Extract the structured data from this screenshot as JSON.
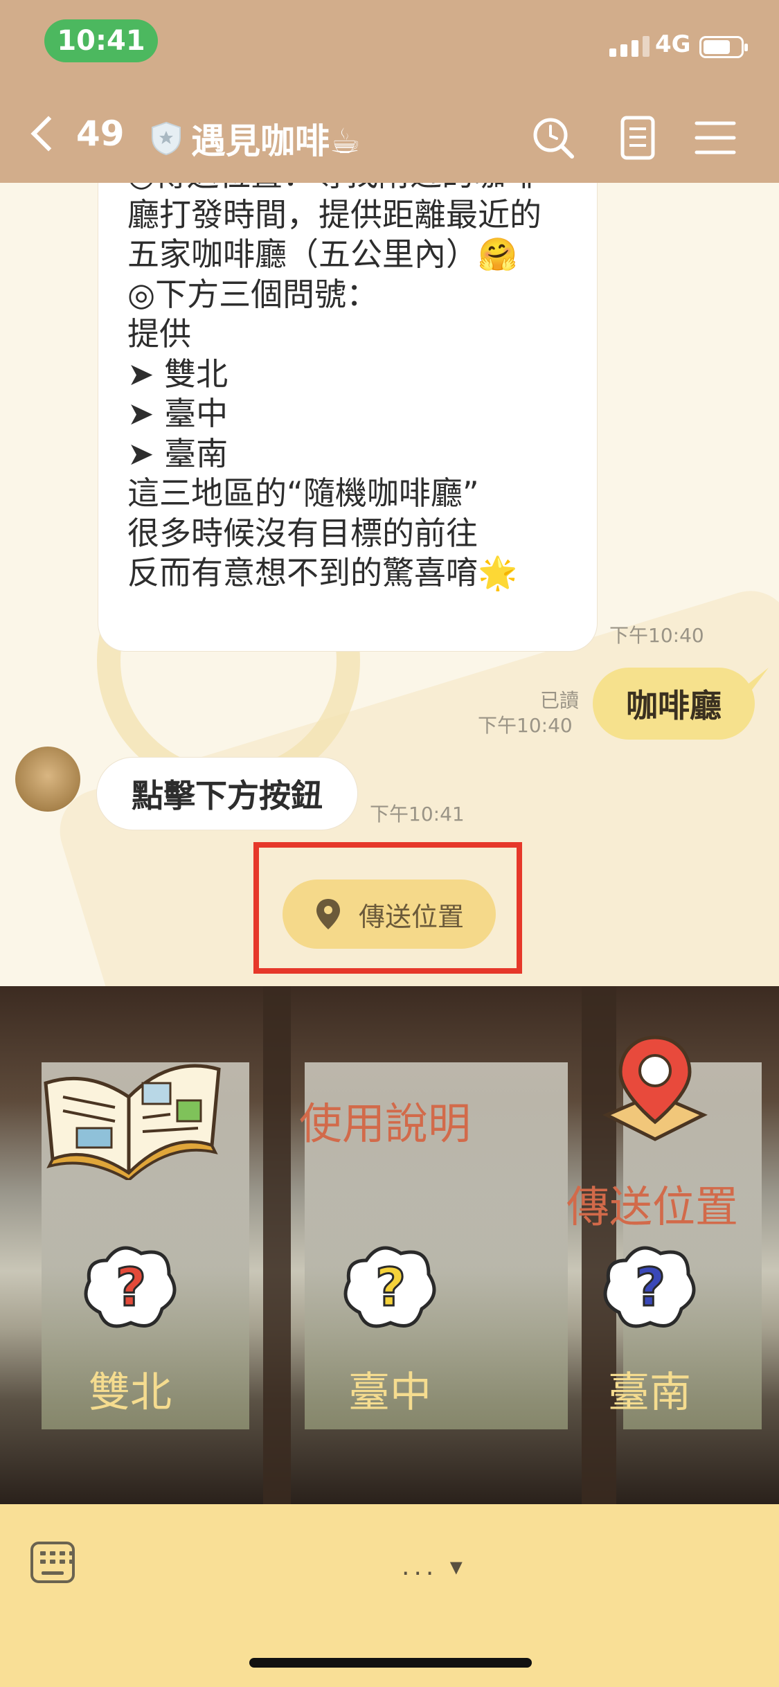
{
  "status": {
    "time": "10:41",
    "network": "4G"
  },
  "nav": {
    "back_count": "49",
    "title": "遇見咖啡☕"
  },
  "chat": {
    "long_message_lines": [
      "◎傳送位置：尋找附近的咖啡",
      "廳打發時間，提供距離最近的",
      "五家咖啡廳（五公里內）🤗",
      "",
      "◎下方三個問號：",
      "提供",
      "➤ 雙北",
      "➤ 臺中",
      "➤ 臺南",
      "這三地區的“隨機咖啡廳”",
      "很多時候沒有目標的前往",
      "反而有意想不到的驚喜唷🌟"
    ],
    "long_message_time": "下午10:40",
    "my_message": "咖啡廳",
    "my_message_read": "已讀",
    "my_message_time": "下午10:40",
    "bot_message": "點擊下方按鈕",
    "bot_message_time": "下午10:41",
    "quick_reply_label": "傳送位置"
  },
  "rich_menu": {
    "guide_label": "使用說明",
    "location_label": "傳送位置",
    "region_1": "雙北",
    "region_2": "臺中",
    "region_3": "臺南"
  },
  "bottom": {
    "menu_toggle": "... ▾"
  },
  "colors": {
    "header": "#d2ad8b",
    "my_bubble": "#f6e18d",
    "quick_reply": "#f5d98a",
    "highlight": "#e6382a",
    "bottom_bar": "#f9df96"
  },
  "icons": [
    "back-chevron-icon",
    "shield-icon",
    "search-icon",
    "notes-icon",
    "menu-icon",
    "location-pin-icon",
    "book-icon",
    "map-pin-icon",
    "question-cloud-icon",
    "keyboard-icon"
  ]
}
